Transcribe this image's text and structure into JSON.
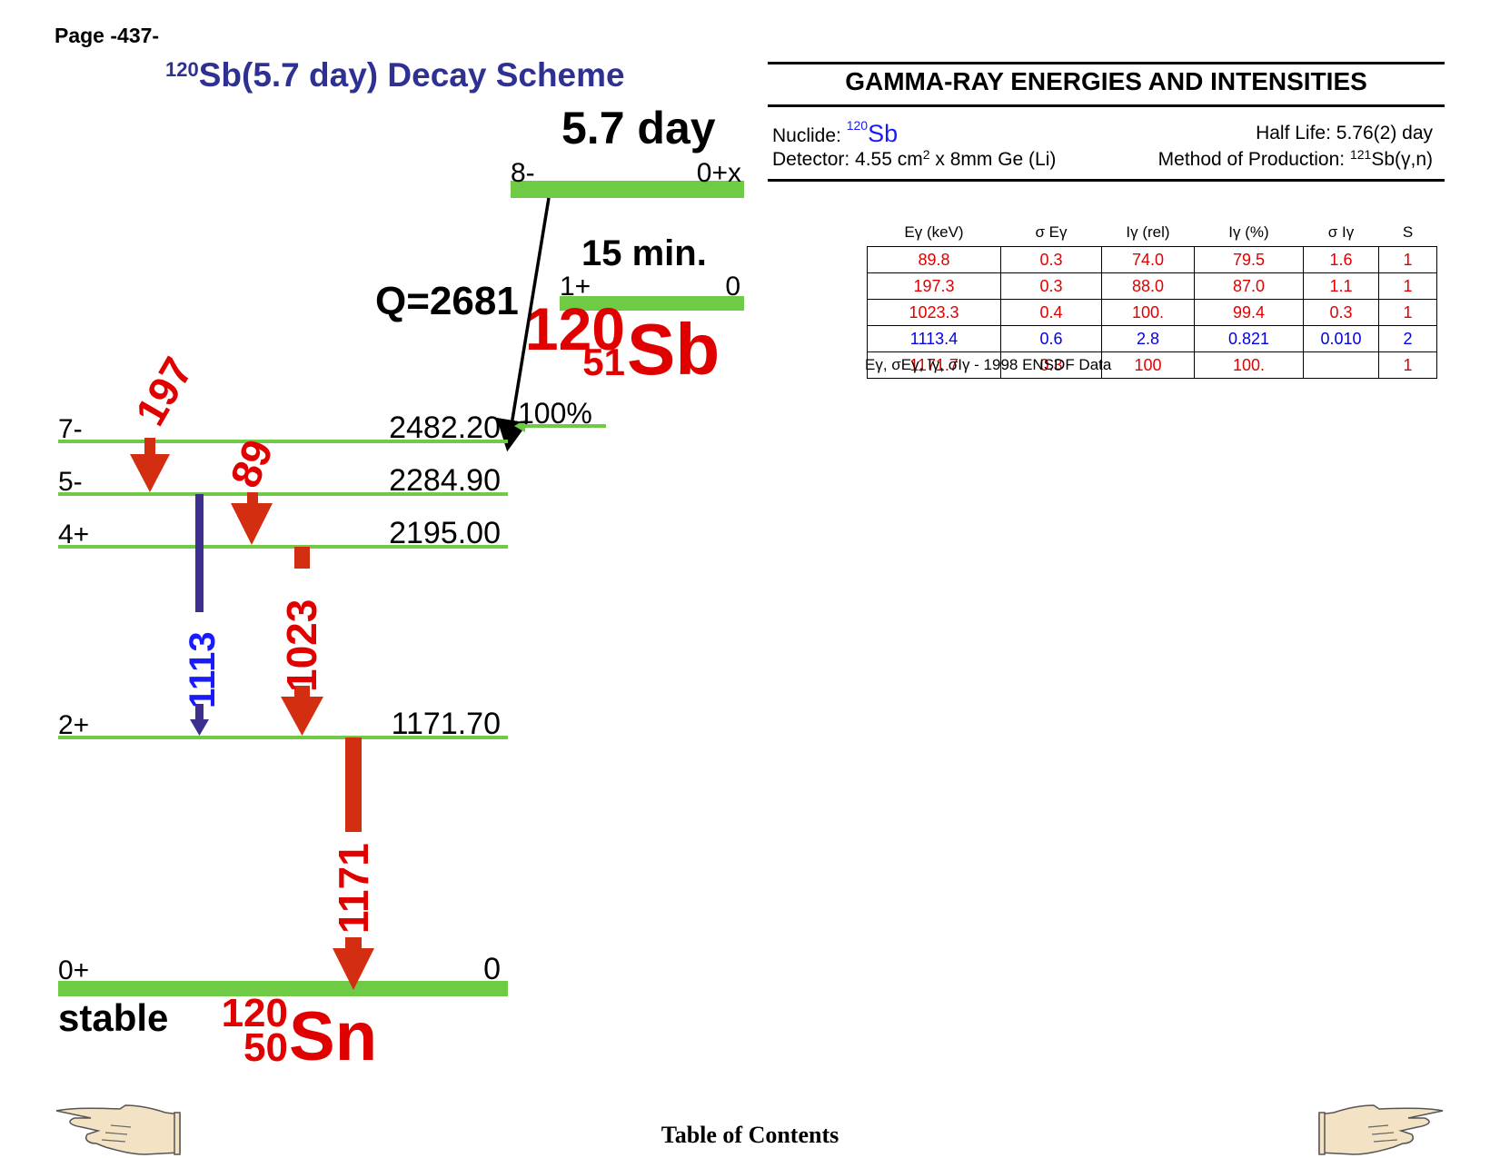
{
  "page_label": "Page -437-",
  "title": {
    "mass_number": "120",
    "text": "Sb(5.7 day) Decay Scheme"
  },
  "parent": {
    "halflife_label": "5.7 day",
    "spin": "8-",
    "energy": "0+x",
    "q_value": "Q=2681",
    "branch": "100%",
    "isomer_halflife": "15 min.",
    "isomer_spin": "1+",
    "isomer_energy": "0",
    "mass_number": "120",
    "atomic_number": "51",
    "element": "Sb"
  },
  "daughter": {
    "mass_number": "120",
    "atomic_number": "50",
    "element": "Sn",
    "stable_label": "stable"
  },
  "levels": [
    {
      "spin": "7-",
      "energy": "2482.20"
    },
    {
      "spin": "5-",
      "energy": "2284.90"
    },
    {
      "spin": "4+",
      "energy": "2195.00"
    },
    {
      "spin": "2+",
      "energy": "1171.70"
    },
    {
      "spin": "0+",
      "energy": "0"
    }
  ],
  "transitions": [
    {
      "label": "197",
      "color": "#d42e12"
    },
    {
      "label": "89",
      "color": "#d42e12"
    },
    {
      "label": "1113",
      "color": "#1a1aff",
      "line_color": "#3d2f8f"
    },
    {
      "label": "1023",
      "color": "#d42e12"
    },
    {
      "label": "1171",
      "color": "#d42e12"
    }
  ],
  "colors": {
    "level_line": "#6fcb46",
    "arrow_red": "#d42e12",
    "label_red": "#e10000",
    "title_blue": "#2f3192"
  },
  "table": {
    "title": "GAMMA-RAY ENERGIES AND INTENSITIES",
    "nuclide_label": "Nuclide: ",
    "nuclide_mass": "120",
    "nuclide_element": "Sb",
    "half_life": "Half Life: 5.76(2) day",
    "detector_pre": "Detector: 4.55 cm",
    "detector_sup": "2",
    "detector_post": " x 8mm Ge (Li)",
    "production_pre": "Method of Production: ",
    "production_sup": "121",
    "production_post": "Sb(γ,n)",
    "headers": [
      "Eγ (keV)",
      "σ Eγ",
      "Iγ (rel)",
      "Iγ (%)",
      "σ Iγ",
      "S"
    ],
    "rows": [
      {
        "cells": [
          "89.8",
          "0.3",
          "74.0",
          "79.5",
          "1.6",
          "1"
        ],
        "color": "red"
      },
      {
        "cells": [
          "197.3",
          "0.3",
          "88.0",
          "87.0",
          "1.1",
          "1"
        ],
        "color": "red"
      },
      {
        "cells": [
          "1023.3",
          "0.4",
          "100.",
          "99.4",
          "0.3",
          "1"
        ],
        "color": "red"
      },
      {
        "cells": [
          "1113.4",
          "0.6",
          "2.8",
          "0.821",
          "0.010",
          "2"
        ],
        "color": "blue"
      },
      {
        "cells": [
          "1171.7",
          "0.3",
          "100",
          "100.",
          "",
          "1"
        ],
        "color": "red"
      }
    ],
    "footnote": "Eγ, σEγ, Iγ, σIγ - 1998 ENSDF Data"
  },
  "footer": {
    "toc": "Table of Contents"
  }
}
